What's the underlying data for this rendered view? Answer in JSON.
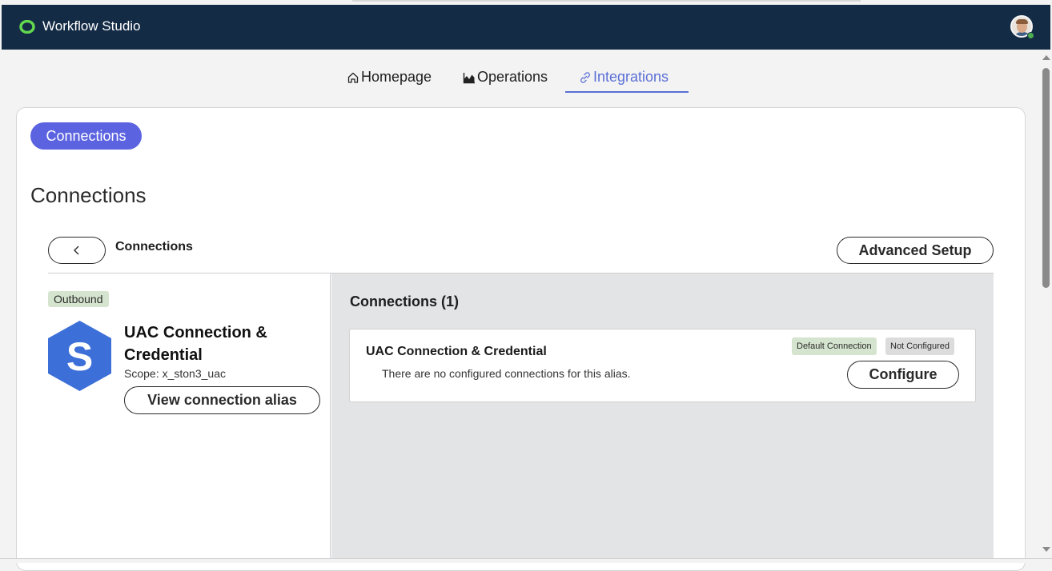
{
  "app": {
    "title": "Workflow Studio"
  },
  "nav": {
    "tabs": [
      {
        "label": "Homepage",
        "icon": "home-icon"
      },
      {
        "label": "Operations",
        "icon": "chart-icon"
      },
      {
        "label": "Integrations",
        "icon": "link-icon",
        "active": true
      }
    ]
  },
  "pill": {
    "label": "Connections"
  },
  "page": {
    "heading": "Connections"
  },
  "subheader": {
    "title": "Connections",
    "advanced_label": "Advanced Setup"
  },
  "alias": {
    "tag": "Outbound",
    "logo_letter": "S",
    "title": "UAC Connection & Credential",
    "scope_label": "Scope:",
    "scope_value": "x_ston3_uac",
    "view_button": "View connection alias"
  },
  "connections": {
    "count_label": "Connections (1)",
    "items": [
      {
        "name": "UAC Connection & Credential",
        "description": "There are no configured connections for this alias.",
        "badges": [
          "Default Connection",
          "Not Configured"
        ],
        "action": "Configure"
      }
    ]
  },
  "colors": {
    "appbar": "#142b45",
    "accent": "#5b63e0",
    "active_tab": "#5a6fd6",
    "logo_blue": "#3d6fd8"
  }
}
